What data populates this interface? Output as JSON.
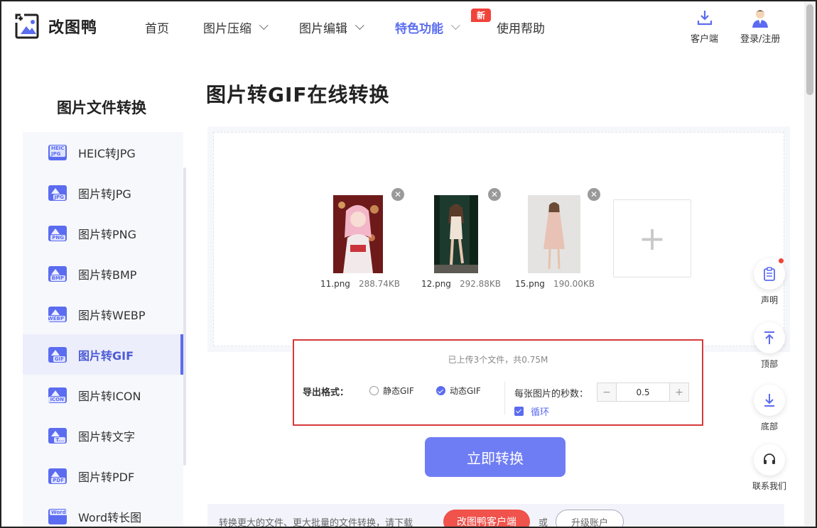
{
  "brand": {
    "name": "改图鸭",
    "accent": "#5b6cf0",
    "badge_color": "#f0433a"
  },
  "nav": {
    "items": [
      {
        "label": "首页"
      },
      {
        "label": "图片压缩"
      },
      {
        "label": "图片编辑"
      },
      {
        "label": "特色功能",
        "badge": "新"
      },
      {
        "label": "使用帮助"
      }
    ]
  },
  "header": {
    "client_label": "客户端",
    "login_label": "登录/注册"
  },
  "sidebar": {
    "title": "图片文件转换",
    "items": [
      {
        "label": "HEIC转JPG",
        "icon": "HEIC JPG"
      },
      {
        "label": "图片转JPG",
        "icon": "JPG"
      },
      {
        "label": "图片转PNG",
        "icon": "PNG"
      },
      {
        "label": "图片转BMP",
        "icon": "BMP"
      },
      {
        "label": "图片转WEBP",
        "icon": "WEBP"
      },
      {
        "label": "图片转GIF",
        "icon": "GIF"
      },
      {
        "label": "图片转ICON",
        "icon": "ICON"
      },
      {
        "label": "图片转文字",
        "icon": "T..."
      },
      {
        "label": "图片转PDF",
        "icon": "PDF"
      },
      {
        "label": "Word转长图",
        "icon": "Word"
      }
    ]
  },
  "main": {
    "title": "图片转GIF在线转换",
    "files": [
      {
        "name": "11.png",
        "size": "288.74KB"
      },
      {
        "name": "12.png",
        "size": "292.88KB"
      },
      {
        "name": "15.png",
        "size": "190.00KB"
      }
    ],
    "add_label": "+",
    "summary": "已上传3个文件，共0.75M",
    "export_label": "导出格式：",
    "format_static": "静态GIF",
    "format_animated": "动态GIF",
    "seconds_label": "每张图片的秒数：",
    "seconds_value": "0.5",
    "minus": "−",
    "plus": "+",
    "loop_label": "循环",
    "convert_label": "立即转换",
    "bottom_text": "转换更大的文件、更大批量的文件转换，请下载",
    "client_button": "改图鸭客户端",
    "or_text": "或",
    "upgrade_button": "升级账户"
  },
  "float": {
    "statement": "声明",
    "top": "顶部",
    "bottom": "底部",
    "contact": "联系我们"
  }
}
